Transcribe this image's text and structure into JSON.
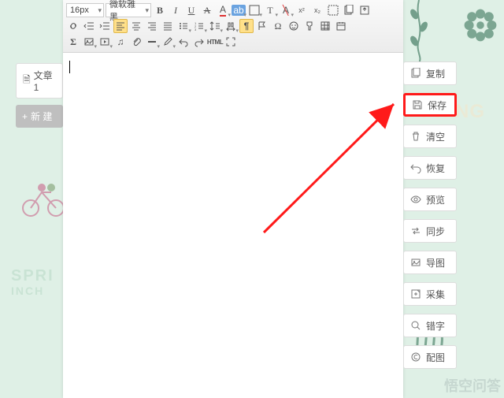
{
  "decor": {
    "spring": "SPRI",
    "inchon": "INCH",
    "phing": "PHING",
    "watermark": "悟空问答"
  },
  "left": {
    "tab1": "文章1",
    "new_label": "新 建"
  },
  "toolbar": {
    "font_size": "16px",
    "font_family": "微软雅黑",
    "html_label": "HTML"
  },
  "actions": [
    {
      "key": "copy",
      "label": "复制",
      "icon": "copy-icon"
    },
    {
      "key": "save",
      "label": "保存",
      "icon": "save-icon",
      "highlight": true
    },
    {
      "key": "clear",
      "label": "清空",
      "icon": "trash-icon"
    },
    {
      "key": "restore",
      "label": "恢复",
      "icon": "undo-icon"
    },
    {
      "key": "preview",
      "label": "预览",
      "icon": "eye-icon"
    },
    {
      "key": "sync",
      "label": "同步",
      "icon": "sync-icon"
    },
    {
      "key": "export",
      "label": "导图",
      "icon": "image-icon"
    },
    {
      "key": "collect",
      "label": "采集",
      "icon": "collect-icon"
    },
    {
      "key": "typo",
      "label": "错字",
      "icon": "search-icon"
    },
    {
      "key": "match",
      "label": "配图",
      "icon": "copyright-icon"
    }
  ]
}
